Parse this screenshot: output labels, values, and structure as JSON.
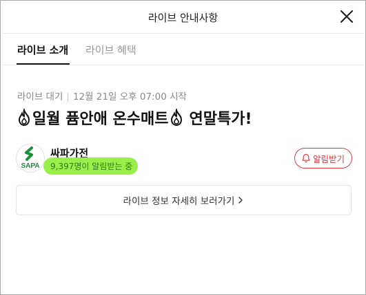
{
  "header": {
    "title": "라이브 안내사항"
  },
  "tabs": [
    {
      "label": "라이브 소개",
      "active": true
    },
    {
      "label": "라이브 혜택",
      "active": false
    }
  ],
  "live": {
    "status": "라이브 대기",
    "schedule": "12월 21일 오후 07:00 시작",
    "title_parts": [
      "일월 퓸안애 온수매트",
      "연말특가!"
    ]
  },
  "seller": {
    "name": "싸파가전",
    "logo_text": "SAPA",
    "subscribers": "9,397명이 알림받는 중"
  },
  "buttons": {
    "alarm_label": "알림받기",
    "detail_label": "라이브 정보 자세히 보러가기"
  },
  "icons": {
    "close": "close-icon",
    "fire": "fire-icon",
    "bell": "bell-icon",
    "chevron": "chevron-right-icon"
  },
  "colors": {
    "accent_red": "#e0393e",
    "highlight_green": "#9af04a",
    "logo_green": "#1a8f3c"
  }
}
